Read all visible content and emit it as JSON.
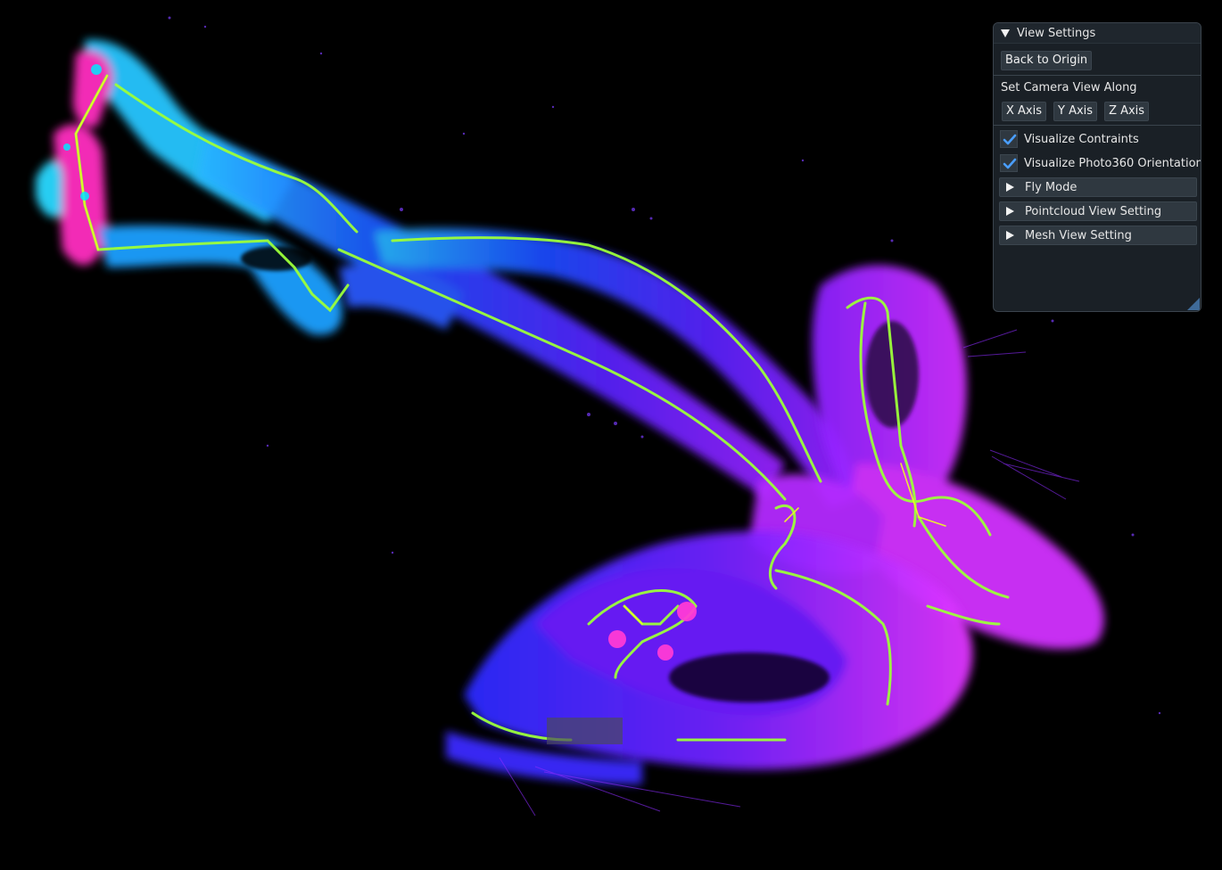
{
  "viewer": {
    "content": "pointcloud-map",
    "background_color": "#000000",
    "colormap": [
      "#00ffff",
      "#00a0ff",
      "#1e3cff",
      "#6a1aff",
      "#b020ff",
      "#e030ff",
      "#ff2db0"
    ],
    "trajectory_colors": [
      "#9cff3a",
      "#f0ff20"
    ]
  },
  "panel": {
    "title": "View Settings",
    "back_to_origin": "Back to Origin",
    "camera_label": "Set Camera View Along",
    "axes": [
      "X Axis",
      "Y Axis",
      "Z Axis"
    ],
    "checkboxes": [
      {
        "label": "Visualize Contraints",
        "checked": true
      },
      {
        "label": "Visualize Photo360 Orientation",
        "checked": true
      }
    ],
    "sections": [
      "Fly Mode",
      "Pointcloud View Setting",
      "Mesh View Setting"
    ],
    "check_color": "#4a9eff"
  }
}
